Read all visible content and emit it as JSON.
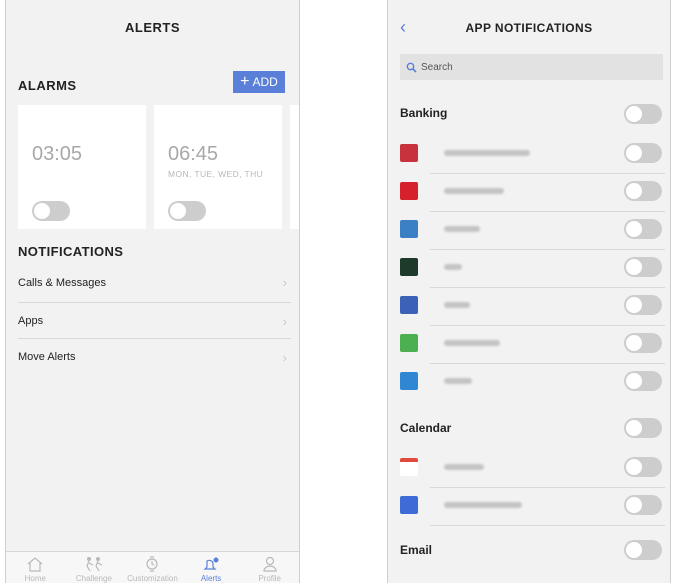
{
  "left": {
    "title": "ALERTS",
    "alarms_header": "ALARMS",
    "add_button": {
      "icon": "plus-icon",
      "label": "ADD"
    },
    "alarms": [
      {
        "time": "03:05",
        "days": "",
        "enabled": false
      },
      {
        "time": "06:45",
        "days": "MON, TUE, WED, THU",
        "enabled": false
      }
    ],
    "notifications_header": "NOTIFICATIONS",
    "notification_rows": [
      {
        "label": "Calls & Messages",
        "icon": "chevron-right-icon"
      },
      {
        "label": "Apps",
        "icon": "chevron-right-icon"
      },
      {
        "label": "Move Alerts",
        "icon": "chevron-right-icon"
      }
    ],
    "tabs": [
      {
        "label": "Home",
        "icon": "home-icon",
        "active": false
      },
      {
        "label": "Challenge",
        "icon": "challenge-icon",
        "active": false
      },
      {
        "label": "Customization",
        "icon": "watch-icon",
        "active": false
      },
      {
        "label": "Alerts",
        "icon": "bell-gear-icon",
        "active": true
      },
      {
        "label": "Profile",
        "icon": "profile-icon",
        "active": false
      }
    ]
  },
  "right": {
    "back_icon": "chevron-left-icon",
    "title": "APP NOTIFICATIONS",
    "search_placeholder": "Search",
    "sections": [
      {
        "name": "Banking",
        "enabled": false,
        "apps": [
          {
            "icon_color": "#c8323c",
            "enabled": false
          },
          {
            "icon_color": "#d6202c",
            "enabled": false
          },
          {
            "icon_color": "#3b7fc4",
            "enabled": false
          },
          {
            "icon_color": "#1e3a2a",
            "enabled": false
          },
          {
            "icon_color": "#3c62b8",
            "enabled": false
          },
          {
            "icon_color": "#4caf50",
            "enabled": false
          },
          {
            "icon_color": "#2f86d2",
            "enabled": false
          }
        ]
      },
      {
        "name": "Calendar",
        "enabled": false,
        "apps": [
          {
            "icon_color": "#e04a3c",
            "enabled": false
          },
          {
            "icon_color": "#3d6cd6",
            "enabled": false
          }
        ]
      },
      {
        "name": "Email",
        "enabled": false,
        "apps": []
      }
    ]
  },
  "colors": {
    "accent": "#5a7fd8",
    "toggle_off": "#cdcdcd",
    "background": "#f2f2f2"
  }
}
